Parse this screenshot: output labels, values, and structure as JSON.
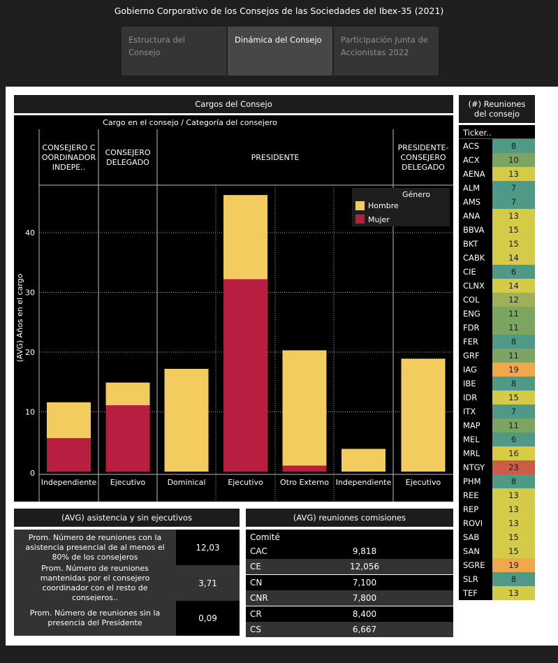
{
  "page": {
    "title": "Gobierno Corporativo de los Consejos de las Sociedades del Ibex-35 (2021)"
  },
  "tabs": [
    {
      "label": "Estructura del Consejo",
      "active": false
    },
    {
      "label": "Dinámica del Consejo",
      "active": true
    },
    {
      "label": "Participación Junta de Accionistas 2022",
      "active": false
    }
  ],
  "cargos": {
    "title": "Cargos del Consejo",
    "subtitle": "Cargo en el consejo  /  Categoría del consejero",
    "groups": [
      {
        "label": "CONSEJERO C OORDINADOR INDEPE..",
        "lines": [
          "CONSEJERO C",
          "OORDINADOR",
          "INDEPE.."
        ]
      },
      {
        "label": "CONSEJERO DELEGADO",
        "lines": [
          "CONSEJERO",
          "DELEGADO"
        ]
      },
      {
        "label": "PRESIDENTE",
        "lines": [
          "PRESIDENTE"
        ]
      },
      {
        "label": "PRESIDENTE-CONSEJERO DELEGADO",
        "lines": [
          "PRESIDENTE-",
          "CONSEJERO",
          "DELEGADO"
        ]
      }
    ],
    "legend": {
      "title": "Género",
      "items": [
        {
          "label": "Hombre",
          "color": "#f2cc5f"
        },
        {
          "label": "Mujer",
          "color": "#b81e40"
        }
      ]
    }
  },
  "chart_data": {
    "type": "bar",
    "stacked": true,
    "ylabel": "(AVG) Años en el cargo",
    "ylim": [
      0,
      48
    ],
    "yticks": [
      0,
      10,
      20,
      30,
      40
    ],
    "grid": true,
    "categories": [
      "Independiente",
      "Ejecutivo",
      "Dominical",
      "Ejecutivo",
      "Otro Externo",
      "Independiente",
      "Ejecutivo"
    ],
    "series": [
      {
        "name": "Mujer",
        "color": "#b81e40",
        "values": [
          5.6,
          11.1,
          0,
          32.2,
          1.0,
          0,
          0
        ]
      },
      {
        "name": "Hombre",
        "color": "#f2cc5f",
        "values": [
          6.0,
          3.8,
          17.2,
          14.1,
          19.3,
          3.8,
          18.9
        ]
      }
    ],
    "legend_position": "top-right"
  },
  "reuniones": {
    "title": "(#) Reuniones del consejo",
    "column_header": "Ticker..",
    "rows": [
      {
        "ticker": "ACS",
        "value": "8",
        "color": "#4e9a86"
      },
      {
        "ticker": "ACX",
        "value": "10",
        "color": "#7ca562"
      },
      {
        "ticker": "AENA",
        "value": "13",
        "color": "#d4cb47"
      },
      {
        "ticker": "ALM",
        "value": "7",
        "color": "#4e9a86"
      },
      {
        "ticker": "AMS",
        "value": "7",
        "color": "#4e9a86"
      },
      {
        "ticker": "ANA",
        "value": "13",
        "color": "#d4cb47"
      },
      {
        "ticker": "BBVA",
        "value": "15",
        "color": "#d4cb47"
      },
      {
        "ticker": "BKT",
        "value": "15",
        "color": "#d4cb47"
      },
      {
        "ticker": "CABK",
        "value": "14",
        "color": "#d4cb47"
      },
      {
        "ticker": "CIE",
        "value": "6",
        "color": "#4e9a86"
      },
      {
        "ticker": "CLNX",
        "value": "14",
        "color": "#d4cb47"
      },
      {
        "ticker": "COL",
        "value": "12",
        "color": "#9fb05a"
      },
      {
        "ticker": "ENG",
        "value": "11",
        "color": "#7ca562"
      },
      {
        "ticker": "FDR",
        "value": "11",
        "color": "#7ca562"
      },
      {
        "ticker": "FER",
        "value": "8",
        "color": "#4e9a86"
      },
      {
        "ticker": "GRF",
        "value": "11",
        "color": "#7ca562"
      },
      {
        "ticker": "IAG",
        "value": "19",
        "color": "#f0a84b"
      },
      {
        "ticker": "IBE",
        "value": "8",
        "color": "#4e9a86"
      },
      {
        "ticker": "IDR",
        "value": "15",
        "color": "#d4cb47"
      },
      {
        "ticker": "ITX",
        "value": "7",
        "color": "#4e9a86"
      },
      {
        "ticker": "MAP",
        "value": "11",
        "color": "#7ca562"
      },
      {
        "ticker": "MEL",
        "value": "6",
        "color": "#4e9a86"
      },
      {
        "ticker": "MRL",
        "value": "16",
        "color": "#d9cb44"
      },
      {
        "ticker": "NTGY",
        "value": "23",
        "color": "#cc5c47"
      },
      {
        "ticker": "PHM",
        "value": "8",
        "color": "#4e9a86"
      },
      {
        "ticker": "REE",
        "value": "13",
        "color": "#d4cb47"
      },
      {
        "ticker": "REP",
        "value": "13",
        "color": "#d4cb47"
      },
      {
        "ticker": "ROVI",
        "value": "13",
        "color": "#d4cb47"
      },
      {
        "ticker": "SAB",
        "value": "15",
        "color": "#d4cb47"
      },
      {
        "ticker": "SAN",
        "value": "15",
        "color": "#d4cb47"
      },
      {
        "ticker": "SGRE",
        "value": "19",
        "color": "#f0a84b"
      },
      {
        "ticker": "SLR",
        "value": "8",
        "color": "#4e9a86"
      },
      {
        "ticker": "TEF",
        "value": "13",
        "color": "#d4cb47"
      }
    ]
  },
  "asistencia": {
    "title": "(AVG) asistencia y sin ejecutivos",
    "rows": [
      {
        "label": "Prom. Número de reuniones con la asistencia presencial de al menos el 80% de los consejeros",
        "value": "12,03"
      },
      {
        "label": "Prom. Número de reuniones mantenidas por el consejero coordinador con el resto de consejeros..",
        "value": "3,71"
      },
      {
        "label": "Prom. Número de reuniones sin la presencia del Presidente",
        "value": "0,09"
      }
    ]
  },
  "comisiones": {
    "title": "(AVG) reuniones comisiones",
    "column_header": "Comité",
    "rows": [
      {
        "name": "CAC",
        "value": "9,818"
      },
      {
        "name": "CE",
        "value": "12,056"
      },
      {
        "name": "CN",
        "value": "7,100"
      },
      {
        "name": "CNR",
        "value": "7,800"
      },
      {
        "name": "CR",
        "value": "8,400"
      },
      {
        "name": "CS",
        "value": "6,667"
      }
    ]
  }
}
